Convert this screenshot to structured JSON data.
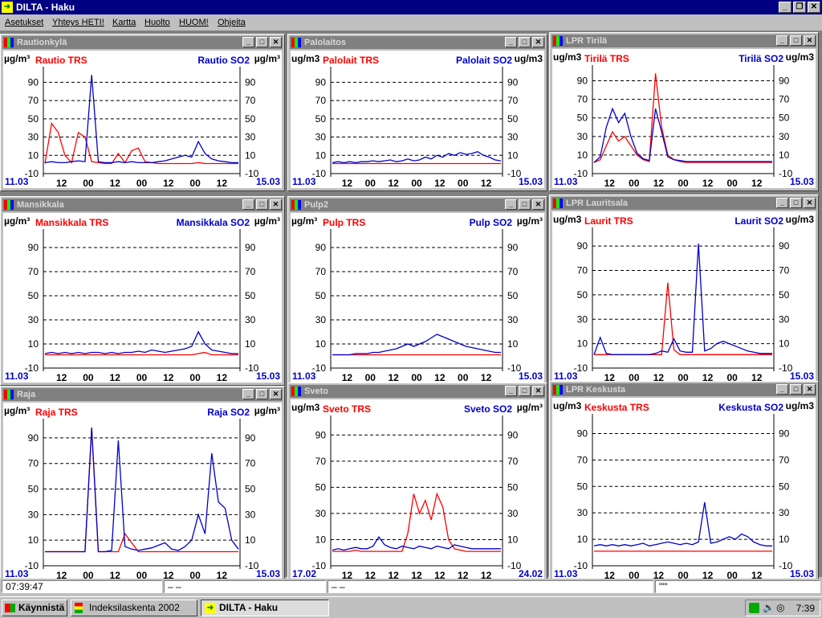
{
  "app": {
    "title": "DILTA - Haku"
  },
  "menu": [
    "Asetukset",
    "Yhteys HETI!",
    "Kartta",
    "Huolto",
    "HUOM!",
    "Ohjeita"
  ],
  "colors": {
    "trs": "#ff0000",
    "so2": "#0000cc",
    "date": "#0000cc"
  },
  "yticks": [
    "90",
    "70",
    "50",
    "30",
    "10",
    "-10"
  ],
  "panels": [
    {
      "title": "Rautionkylä",
      "unit_left": "µg/m³",
      "unit_right": "µg/m³",
      "trs": "Rautio TRS",
      "so2": "Rautio SO2",
      "x_start": "11.03",
      "x_end": "15.03",
      "xticks": [
        "12",
        "00",
        "12",
        "00",
        "12",
        "00",
        "12"
      ],
      "chart_data": {
        "type": "line",
        "x_start": "11.03",
        "x_end": "15.03",
        "ylim": [
          -10,
          100
        ],
        "series": [
          {
            "name": "Rautio TRS",
            "values": [
              1,
              45,
              35,
              10,
              2,
              35,
              30,
              3,
              2,
              1,
              1,
              12,
              2,
              15,
              18,
              3,
              2,
              1,
              1,
              1,
              1,
              1,
              1,
              2,
              1,
              1,
              1,
              1,
              1,
              1
            ]
          },
          {
            "name": "Rautio SO2",
            "values": [
              2,
              3,
              2,
              2,
              3,
              4,
              3,
              98,
              3,
              2,
              2,
              3,
              2,
              3,
              2,
              2,
              2,
              3,
              4,
              6,
              8,
              10,
              8,
              25,
              12,
              6,
              4,
              3,
              2,
              2
            ]
          }
        ]
      }
    },
    {
      "title": "Palolaitos",
      "unit_left": "ug/m3",
      "unit_right": "ug/m3",
      "trs": "Palolait TRS",
      "so2": "Palolait SO2",
      "x_start": "11.03",
      "x_end": "15.03",
      "xticks": [
        "12",
        "00",
        "12",
        "00",
        "12",
        "00",
        "12"
      ],
      "chart_data": {
        "type": "line",
        "x_start": "11.03",
        "x_end": "15.03",
        "ylim": [
          -10,
          100
        ],
        "series": [
          {
            "name": "Palolait TRS",
            "values": [
              1,
              1,
              1,
              1,
              1,
              1,
              1,
              1,
              1,
              1,
              1,
              1,
              1,
              1,
              1,
              1,
              1,
              1,
              1,
              1,
              1,
              1,
              1,
              1,
              1,
              1,
              1,
              1,
              1,
              1
            ]
          },
          {
            "name": "Palolait SO2",
            "values": [
              2,
              3,
              2,
              3,
              2,
              3,
              3,
              4,
              3,
              4,
              5,
              3,
              4,
              6,
              4,
              5,
              8,
              6,
              10,
              8,
              12,
              10,
              13,
              11,
              12,
              14,
              10,
              8,
              5,
              4
            ]
          }
        ]
      }
    },
    {
      "title": "LPR Tirilä",
      "unit_left": "ug/m3",
      "unit_right": "ug/m3",
      "trs": "Tirilä TRS",
      "so2": "Tirilä SO2",
      "x_start": "11.03",
      "x_end": "15.03",
      "xticks": [
        "12",
        "00",
        "12",
        "00",
        "12",
        "00",
        "12"
      ],
      "chart_data": {
        "type": "line",
        "x_start": "11.03",
        "x_end": "15.03",
        "ylim": [
          -10,
          100
        ],
        "series": [
          {
            "name": "Tirilä TRS",
            "values": [
              2,
              5,
              20,
              35,
              25,
              30,
              20,
              10,
              5,
              3,
              98,
              40,
              10,
              5,
              3,
              2,
              2,
              2,
              2,
              2,
              2,
              2,
              2,
              2,
              2,
              2,
              2,
              2,
              2,
              2
            ]
          },
          {
            "name": "Tirilä SO2",
            "values": [
              2,
              8,
              40,
              60,
              45,
              55,
              30,
              12,
              6,
              4,
              60,
              35,
              8,
              5,
              4,
              3,
              3,
              3,
              3,
              3,
              3,
              3,
              3,
              3,
              3,
              3,
              3,
              3,
              3,
              3
            ]
          }
        ]
      }
    },
    {
      "title": "Mansikkala",
      "unit_left": "µg/m³",
      "unit_right": "µg/m³",
      "trs": "Mansikkala TRS",
      "so2": "Mansikkala SO2",
      "x_start": "11.03",
      "x_end": "15.03",
      "xticks": [
        "12",
        "00",
        "12",
        "00",
        "12",
        "00",
        "12"
      ],
      "chart_data": {
        "type": "line",
        "x_start": "11.03",
        "x_end": "15.03",
        "ylim": [
          -10,
          100
        ],
        "series": [
          {
            "name": "Mansikkala TRS",
            "values": [
              1,
              1,
              1,
              1,
              1,
              1,
              1,
              1,
              1,
              1,
              1,
              1,
              1,
              1,
              1,
              1,
              1,
              1,
              1,
              1,
              1,
              1,
              1,
              2,
              3,
              1,
              1,
              1,
              1,
              1
            ]
          },
          {
            "name": "Mansikkala SO2",
            "values": [
              2,
              3,
              2,
              3,
              2,
              3,
              2,
              3,
              3,
              2,
              3,
              2,
              3,
              3,
              4,
              3,
              5,
              4,
              3,
              4,
              5,
              6,
              8,
              20,
              10,
              5,
              4,
              3,
              2,
              2
            ]
          }
        ]
      }
    },
    {
      "title": "Pulp2",
      "unit_left": "µg/m³",
      "unit_right": "µg/m³",
      "trs": "Pulp TRS",
      "so2": "Pulp SO2",
      "x_start": "11.03",
      "x_end": "15.03",
      "xticks": [
        "12",
        "00",
        "12",
        "00",
        "12",
        "00",
        "12"
      ],
      "chart_data": {
        "type": "line",
        "x_start": "11.03",
        "x_end": "15.03",
        "ylim": [
          -10,
          100
        ],
        "series": [
          {
            "name": "Pulp TRS",
            "values": [
              1,
              1,
              1,
              1,
              1,
              1,
              1,
              1,
              1,
              1,
              1,
              1,
              1,
              1,
              1,
              1,
              1,
              1,
              1,
              1,
              1,
              1,
              1,
              1,
              1,
              1,
              1,
              1,
              1,
              1
            ]
          },
          {
            "name": "Pulp SO2",
            "values": [
              1,
              1,
              1,
              1,
              2,
              2,
              2,
              3,
              3,
              4,
              5,
              6,
              8,
              10,
              8,
              10,
              12,
              15,
              18,
              16,
              14,
              12,
              10,
              8,
              7,
              6,
              5,
              4,
              3,
              3
            ]
          }
        ]
      }
    },
    {
      "title": "LPR Lauritsala",
      "unit_left": "ug/m3",
      "unit_right": "ug/m3",
      "trs": "Laurit TRS",
      "so2": "Laurit SO2",
      "x_start": "11.03",
      "x_end": "15.03",
      "xticks": [
        "12",
        "00",
        "12",
        "00",
        "12",
        "00",
        "12"
      ],
      "chart_data": {
        "type": "line",
        "x_start": "11.03",
        "x_end": "15.03",
        "ylim": [
          -10,
          100
        ],
        "series": [
          {
            "name": "Laurit TRS",
            "values": [
              1,
              1,
              1,
              1,
              1,
              1,
              1,
              1,
              1,
              1,
              1,
              1,
              60,
              5,
              1,
              1,
              1,
              1,
              1,
              1,
              1,
              1,
              1,
              1,
              1,
              1,
              1,
              1,
              1,
              1
            ]
          },
          {
            "name": "Laurit SO2",
            "values": [
              1,
              15,
              2,
              1,
              1,
              1,
              1,
              1,
              1,
              1,
              2,
              4,
              3,
              14,
              4,
              3,
              3,
              92,
              4,
              6,
              10,
              12,
              10,
              8,
              6,
              4,
              3,
              2,
              2,
              2
            ]
          }
        ]
      }
    },
    {
      "title": "Raja",
      "unit_left": "µg/m³",
      "unit_right": "µg/m³",
      "trs": "Raja TRS",
      "so2": "Raja SO2",
      "x_start": "11.03",
      "x_end": "15.03",
      "xticks": [
        "12",
        "00",
        "12",
        "00",
        "12",
        "00",
        "12"
      ],
      "chart_data": {
        "type": "line",
        "x_start": "11.03",
        "x_end": "15.03",
        "ylim": [
          -10,
          100
        ],
        "series": [
          {
            "name": "Raja TRS",
            "values": [
              1,
              1,
              1,
              1,
              1,
              1,
              1,
              98,
              1,
              1,
              1,
              1,
              15,
              8,
              1,
              1,
              1,
              1,
              1,
              1,
              1,
              1,
              1,
              1,
              1,
              1,
              1,
              1,
              1,
              1
            ]
          },
          {
            "name": "Raja SO2",
            "values": [
              1,
              1,
              1,
              1,
              1,
              1,
              1,
              98,
              1,
              1,
              2,
              88,
              5,
              3,
              2,
              3,
              4,
              6,
              8,
              3,
              2,
              5,
              10,
              30,
              15,
              78,
              40,
              35,
              10,
              3
            ]
          }
        ]
      }
    },
    {
      "title": "Sveto",
      "unit_left": "ug/m3",
      "unit_right": "µg/m³",
      "trs": "Sveto TRS",
      "so2": "Sveto SO2",
      "x_start": "17.02",
      "x_end": "24.02",
      "xticks": [
        "12",
        "12",
        "12",
        "12",
        "12",
        "12",
        "12"
      ],
      "chart_data": {
        "type": "line",
        "x_start": "17.02",
        "x_end": "24.02",
        "ylim": [
          -10,
          100
        ],
        "series": [
          {
            "name": "Sveto TRS",
            "values": [
              1,
              1,
              1,
              1,
              2,
              1,
              1,
              1,
              1,
              1,
              1,
              1,
              1,
              15,
              45,
              30,
              40,
              25,
              45,
              35,
              10,
              3,
              2,
              1,
              1,
              1,
              1,
              1,
              1,
              1
            ]
          },
          {
            "name": "Sveto SO2",
            "values": [
              2,
              3,
              2,
              3,
              4,
              3,
              3,
              5,
              12,
              6,
              4,
              3,
              5,
              4,
              3,
              5,
              4,
              3,
              5,
              4,
              3,
              6,
              5,
              4,
              3,
              3,
              3,
              3,
              3,
              3
            ]
          }
        ]
      }
    },
    {
      "title": "LPR Keskusta",
      "unit_left": "ug/m3",
      "unit_right": "ug/m3",
      "trs": "Keskusta TRS",
      "so2": "Keskusta SO2",
      "x_start": "11.03",
      "x_end": "15.03",
      "xticks": [
        "12",
        "00",
        "12",
        "00",
        "12",
        "00",
        "12"
      ],
      "chart_data": {
        "type": "line",
        "x_start": "11.03",
        "x_end": "15.03",
        "ylim": [
          -10,
          100
        ],
        "series": [
          {
            "name": "Keskusta TRS",
            "values": [
              1,
              1,
              1,
              1,
              1,
              1,
              1,
              1,
              1,
              1,
              1,
              1,
              1,
              1,
              1,
              1,
              1,
              1,
              1,
              1,
              1,
              1,
              1,
              1,
              1,
              1,
              1,
              1,
              1,
              1
            ]
          },
          {
            "name": "Keskusta SO2",
            "values": [
              5,
              6,
              5,
              6,
              5,
              6,
              5,
              6,
              7,
              5,
              6,
              7,
              8,
              7,
              6,
              7,
              6,
              8,
              38,
              7,
              8,
              10,
              12,
              10,
              14,
              12,
              8,
              6,
              5,
              5
            ]
          }
        ]
      }
    }
  ],
  "status": {
    "time": "07:39:47",
    "field2": "– –",
    "field3": "– –",
    "field4": "\"\"'"
  },
  "taskbar": {
    "start": "Käynnistä",
    "task1": "Indeksilaskenta 2002",
    "task2": "DILTA - Haku",
    "clock": "7:39"
  }
}
